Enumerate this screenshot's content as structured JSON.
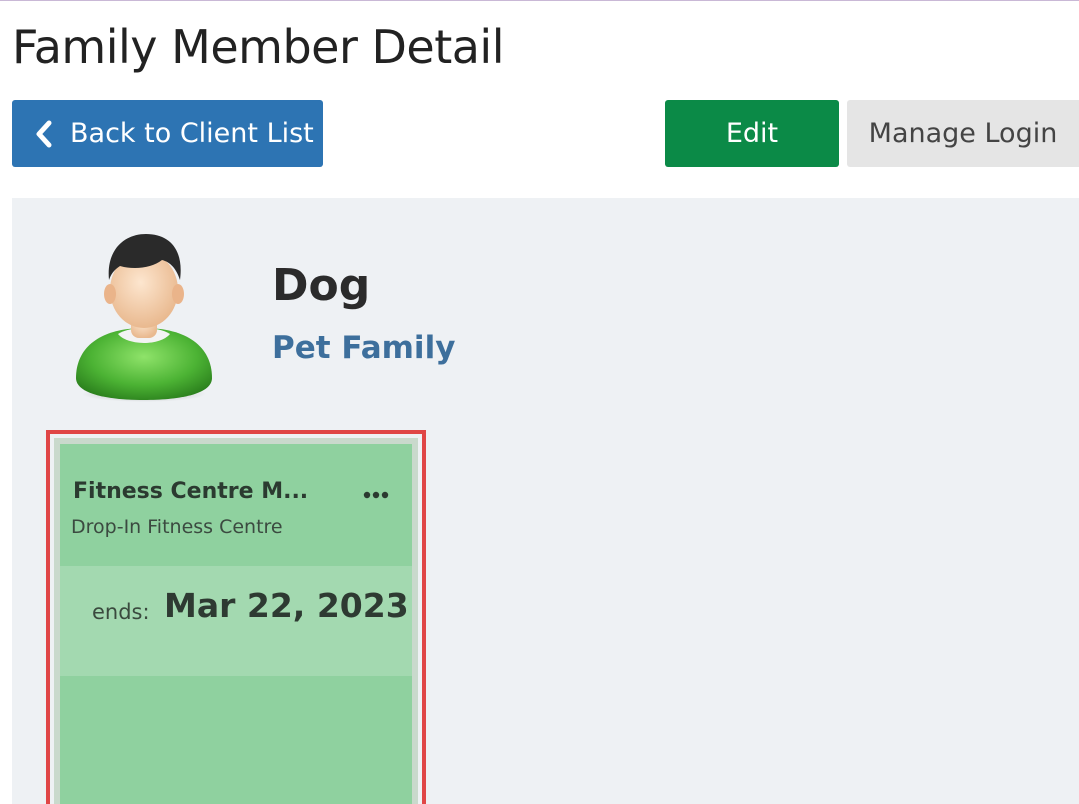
{
  "header": {
    "title": "Family Member Detail"
  },
  "toolbar": {
    "back_label": "Back to Client List",
    "edit_label": "Edit",
    "manage_login_label": "Manage Login"
  },
  "client": {
    "name": "Dog",
    "family": "Pet Family",
    "avatar_icon": "person-avatar-icon"
  },
  "membership_card": {
    "title": "Fitness Centre M...",
    "subtitle": "Drop-In Fitness Centre",
    "ends_label": "ends:",
    "ends_date": "Mar 22, 2023",
    "menu_icon": "ellipsis-icon"
  },
  "colors": {
    "back_button": "#2d74b3",
    "edit_button": "#0b8a47",
    "manage_button": "#e5e5e5",
    "card_green": "#8fd19f",
    "highlight": "#e04646",
    "family_link": "#3d6f9c"
  }
}
